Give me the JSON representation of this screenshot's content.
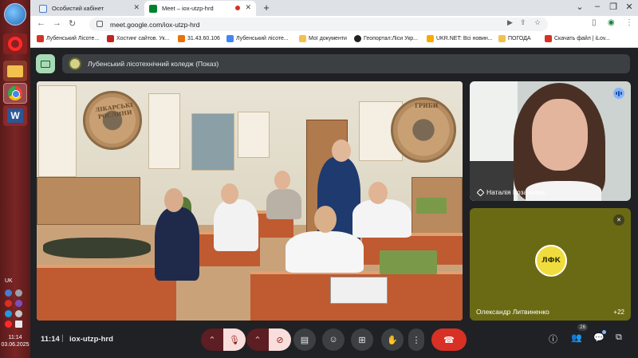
{
  "taskbar": {
    "lang": "UK",
    "clock_time": "11:14",
    "clock_date": "03.06.2025"
  },
  "browser": {
    "tabs": [
      {
        "label": "Особистий кабінет"
      },
      {
        "label": "Meet – iox-utzp-hrd"
      }
    ],
    "url": "meet.google.com/iox-utzp-hrd",
    "bookmarks": [
      {
        "label": "Лубенський Лісоте...",
        "color": "#d93025"
      },
      {
        "label": "Хостинг сайтов. Ук...",
        "color": "#c5221f"
      },
      {
        "label": "31.43.60.106",
        "color": "#e8710a"
      },
      {
        "label": "Лубенський лісоте...",
        "color": "#4285f4"
      },
      {
        "label": "Мої документи",
        "color": "#f2c14e"
      },
      {
        "label": "Геопортал:Ліси Укр...",
        "color": "#202124"
      },
      {
        "label": "UKR.NET: Всі новин...",
        "color": "#f9ab00"
      },
      {
        "label": "ПОГОДА",
        "color": "#f2c14e"
      },
      {
        "label": "Скачать файл | iLov...",
        "color": "#d93025"
      }
    ]
  },
  "meet": {
    "presentation_title": "Лубенський лісотехнічний коледж (Показ)",
    "main_banner_left": "ЛІКАРСЬКІ РОСЛИНИ",
    "main_banner_right": "ГРИБИ",
    "participants": [
      {
        "name": "Наталія Козачкова",
        "speaking": true
      },
      {
        "name": "Олександр Литвиненко",
        "muted": true,
        "logo_text": "ЛФК"
      }
    ],
    "more_participants": "+22",
    "time": "11:14",
    "separator": "|",
    "meeting_code": "iox-utzp-hrd",
    "people_count": "26",
    "controls": [
      {
        "name": "mic-options",
        "icon": "chevron-up-icon"
      },
      {
        "name": "mic",
        "icon": "mic-off-icon"
      },
      {
        "name": "camera-options",
        "icon": "chevron-up-icon"
      },
      {
        "name": "camera",
        "icon": "camera-off-icon"
      },
      {
        "name": "captions",
        "icon": "captions-icon"
      },
      {
        "name": "emoji",
        "icon": "emoji-icon"
      },
      {
        "name": "present",
        "icon": "present-icon"
      },
      {
        "name": "raise-hand",
        "icon": "hand-icon"
      },
      {
        "name": "more",
        "icon": "more-vert-icon"
      },
      {
        "name": "leave",
        "icon": "phone-hangup-icon"
      }
    ]
  },
  "colors": {
    "accent_red": "#d93025",
    "meet_bg": "#202124",
    "tile_dark": "#3c4043"
  }
}
